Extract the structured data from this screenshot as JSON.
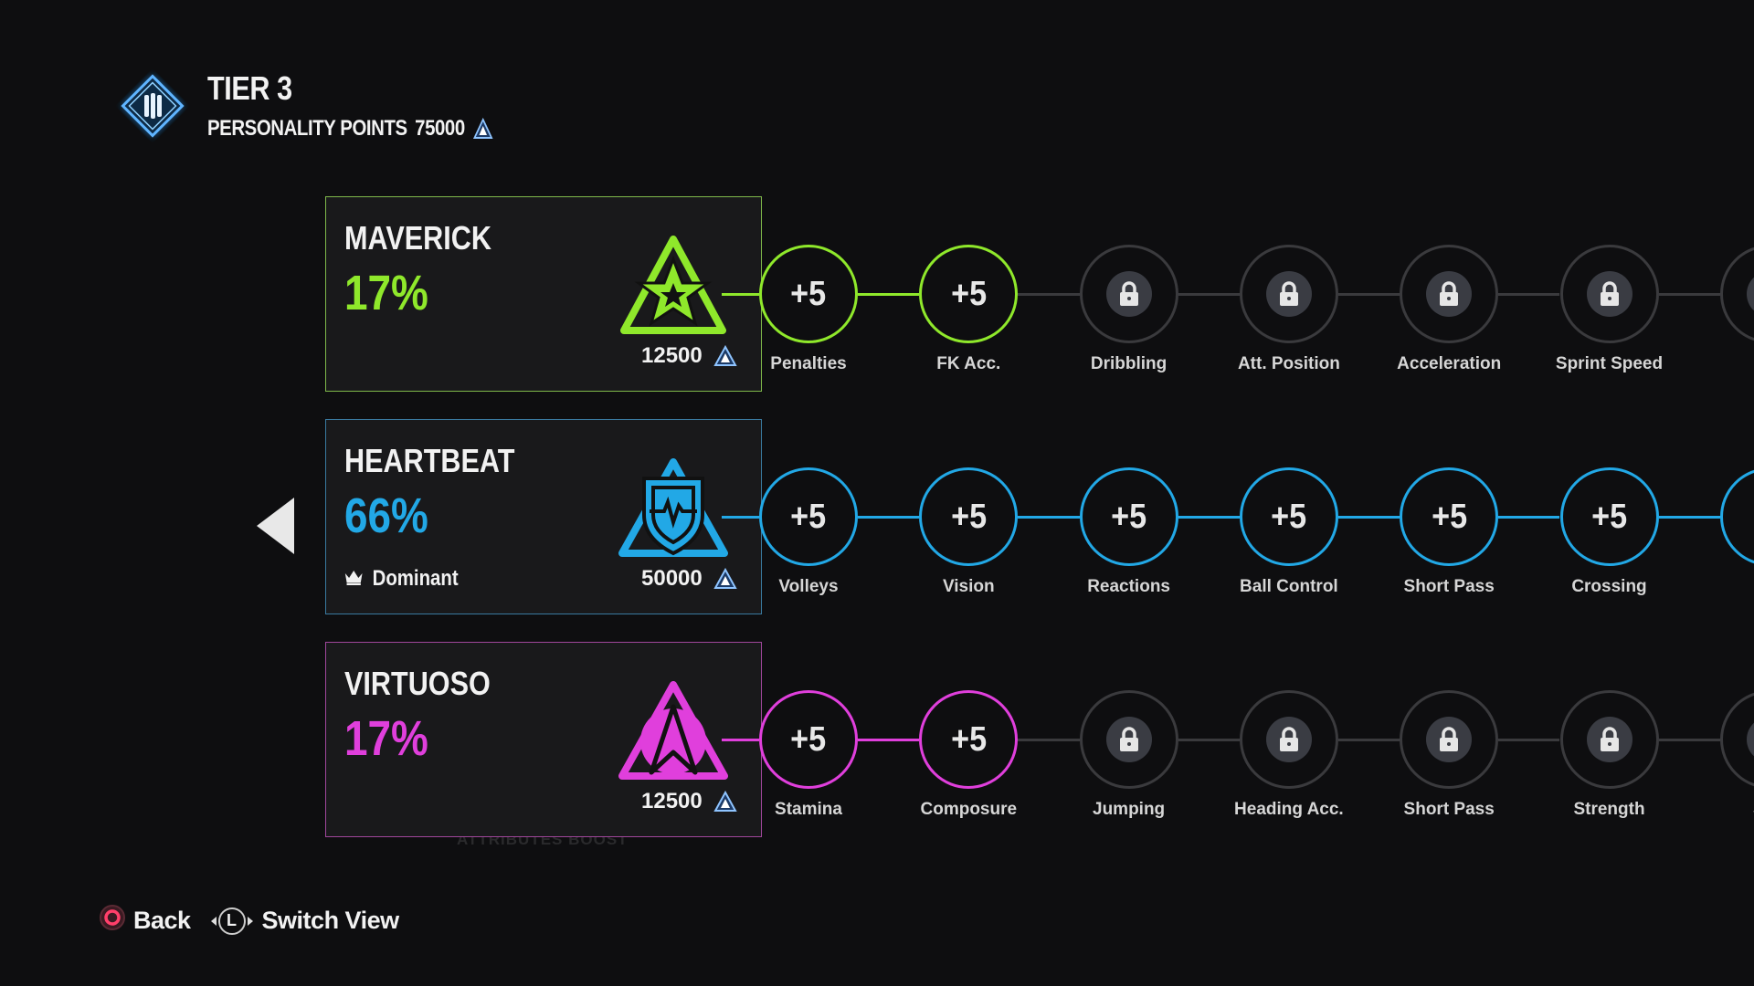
{
  "header": {
    "title": "TIER 3",
    "points_label": "PERSONALITY POINTS",
    "points_value": "75000",
    "icon": "tier-diamond-icon"
  },
  "background_text": "ATTRIBUTES BOOST",
  "colors": {
    "maverick": "#8fe82b",
    "heartbeat": "#22a8e6",
    "virtuoso": "#e03fdc",
    "locked": "#3a3a3d"
  },
  "rows": [
    {
      "key": "maverick",
      "name": "MAVERICK",
      "percent": "17%",
      "badge": null,
      "points": "12500",
      "color": "#8fe82b",
      "border": "#7fb84a",
      "emblem": "star",
      "nodes": [
        {
          "value": "+5",
          "label": "Penalties",
          "locked": false
        },
        {
          "value": "+5",
          "label": "FK Acc.",
          "locked": false
        },
        {
          "value": null,
          "label": "Dribbling",
          "locked": true
        },
        {
          "value": null,
          "label": "Att. Position",
          "locked": true
        },
        {
          "value": null,
          "label": "Acceleration",
          "locked": true
        },
        {
          "value": null,
          "label": "Sprint Speed",
          "locked": true
        },
        {
          "value": null,
          "label": "Fi",
          "locked": true
        }
      ]
    },
    {
      "key": "heartbeat",
      "name": "HEARTBEAT",
      "percent": "66%",
      "badge": "Dominant",
      "points": "50000",
      "color": "#22a8e6",
      "border": "#3a7aa0",
      "emblem": "shield",
      "nodes": [
        {
          "value": "+5",
          "label": "Volleys",
          "locked": false
        },
        {
          "value": "+5",
          "label": "Vision",
          "locked": false
        },
        {
          "value": "+5",
          "label": "Reactions",
          "locked": false
        },
        {
          "value": "+5",
          "label": "Ball Control",
          "locked": false
        },
        {
          "value": "+5",
          "label": "Short Pass",
          "locked": false
        },
        {
          "value": "+5",
          "label": "Crossing",
          "locked": false
        },
        {
          "value": "+",
          "label": "Lon",
          "locked": false
        }
      ]
    },
    {
      "key": "virtuoso",
      "name": "VIRTUOSO",
      "percent": "17%",
      "badge": null,
      "points": "12500",
      "color": "#e03fdc",
      "border": "#a0479c",
      "emblem": "arrow",
      "nodes": [
        {
          "value": "+5",
          "label": "Stamina",
          "locked": false
        },
        {
          "value": "+5",
          "label": "Composure",
          "locked": false
        },
        {
          "value": null,
          "label": "Jumping",
          "locked": true
        },
        {
          "value": null,
          "label": "Heading Acc.",
          "locked": true
        },
        {
          "value": null,
          "label": "Short Pass",
          "locked": true
        },
        {
          "value": null,
          "label": "Strength",
          "locked": true
        },
        {
          "value": null,
          "label": "Sho",
          "locked": true
        }
      ]
    }
  ],
  "footer": {
    "back_label": "Back",
    "switch_label": "Switch View",
    "stick_letter": "L"
  }
}
